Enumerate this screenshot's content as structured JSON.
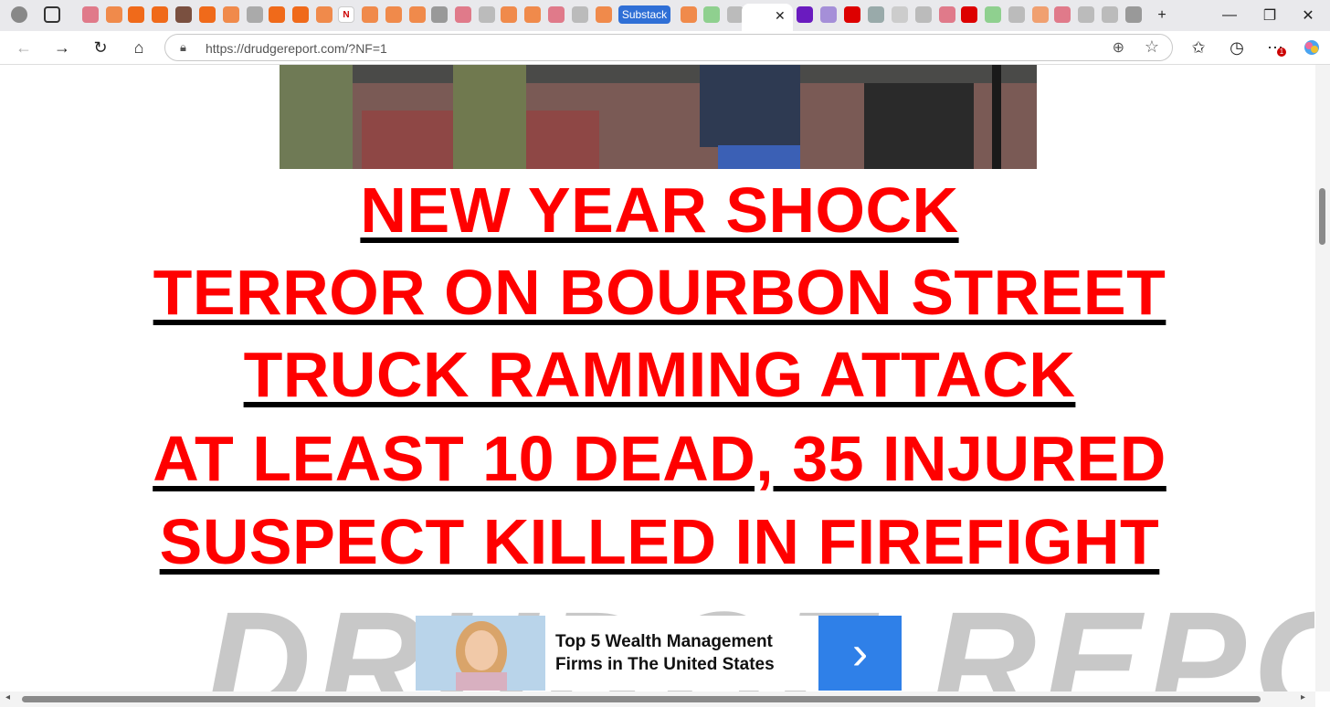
{
  "browser": {
    "substack_tab_label": "Substack",
    "active_tab_close": "✕",
    "new_tab": "+",
    "minimize": "—",
    "restore": "❐",
    "close": "✕"
  },
  "nav": {
    "url": "https://drudgereport.com/?NF=1",
    "notification_badge": "1"
  },
  "headlines": [
    "NEW YEAR SHOCK",
    "TERROR ON BOURBON STREET",
    "TRUCK RAMMING ATTACK",
    "AT LEAST 10 DEAD, 35 INJURED",
    "SUSPECT KILLED IN FIREFIGHT"
  ],
  "logo_text": "DRUDGE REPORT",
  "ad": {
    "text": "Top 5 Wealth Management Firms in The United States",
    "button_icon": "chevron-right-icon"
  },
  "colors": {
    "headline": "#ff0000",
    "underline": "#000000",
    "ad_button": "#2f80e8"
  }
}
